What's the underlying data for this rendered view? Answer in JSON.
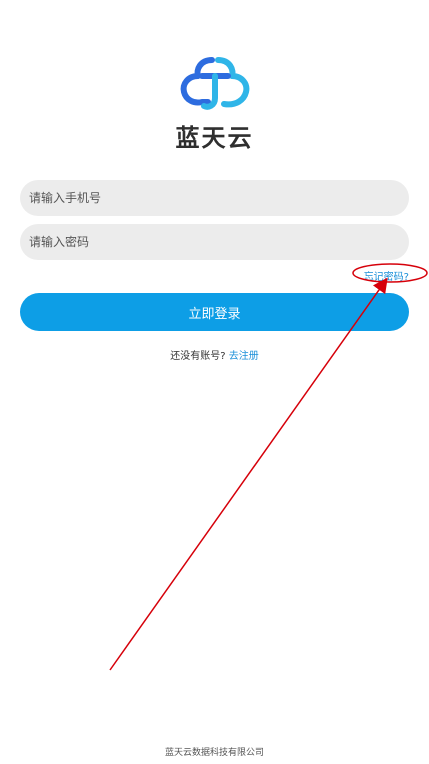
{
  "brand": {
    "name": "蓝天云",
    "logo_icon": "cloud-logo-icon",
    "colors": [
      "#2d6cdf",
      "#2fb5e8"
    ]
  },
  "login": {
    "phone_placeholder": "请输入手机号",
    "password_placeholder": "请输入密码",
    "forgot_label": "忘记密码?",
    "submit_label": "立即登录",
    "no_account_text": "还没有账号?",
    "register_label": "去注册"
  },
  "footer": {
    "company": "蓝天云数据科技有限公司"
  },
  "colors": {
    "accent": "#0d9ee6",
    "link": "#1a8fd8",
    "field_bg": "#ececec",
    "annotation": "#d6000a"
  }
}
